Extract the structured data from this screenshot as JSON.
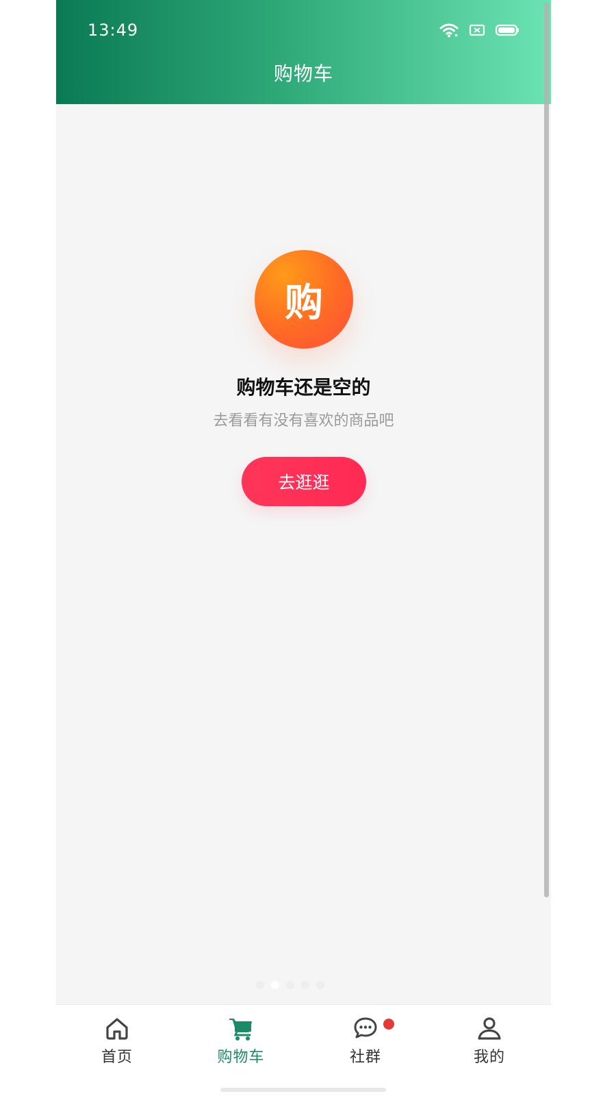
{
  "status_bar": {
    "time": "13:49",
    "icons": [
      "wifi-icon",
      "sim-icon",
      "battery-icon"
    ]
  },
  "header": {
    "title": "购物车"
  },
  "empty_state": {
    "badge_text": "购",
    "title": "购物车还是空的",
    "subtitle": "去看看有没有喜欢的商品吧",
    "button_label": "去逛逛"
  },
  "tabs": [
    {
      "label": "首页",
      "icon": "home-icon",
      "active": false
    },
    {
      "label": "购物车",
      "icon": "cart-icon",
      "active": true
    },
    {
      "label": "社群",
      "icon": "chat-bubble-icon",
      "active": false,
      "badge": true
    },
    {
      "label": "我的",
      "icon": "user-icon",
      "active": false
    }
  ],
  "colors": {
    "header_start": "#0a7a55",
    "header_end": "#6be3b2",
    "accent_green": "#1b8a66",
    "button_red": "#ff2a55",
    "badge_orange": "#ff6a24",
    "notification_dot": "#e53935"
  }
}
